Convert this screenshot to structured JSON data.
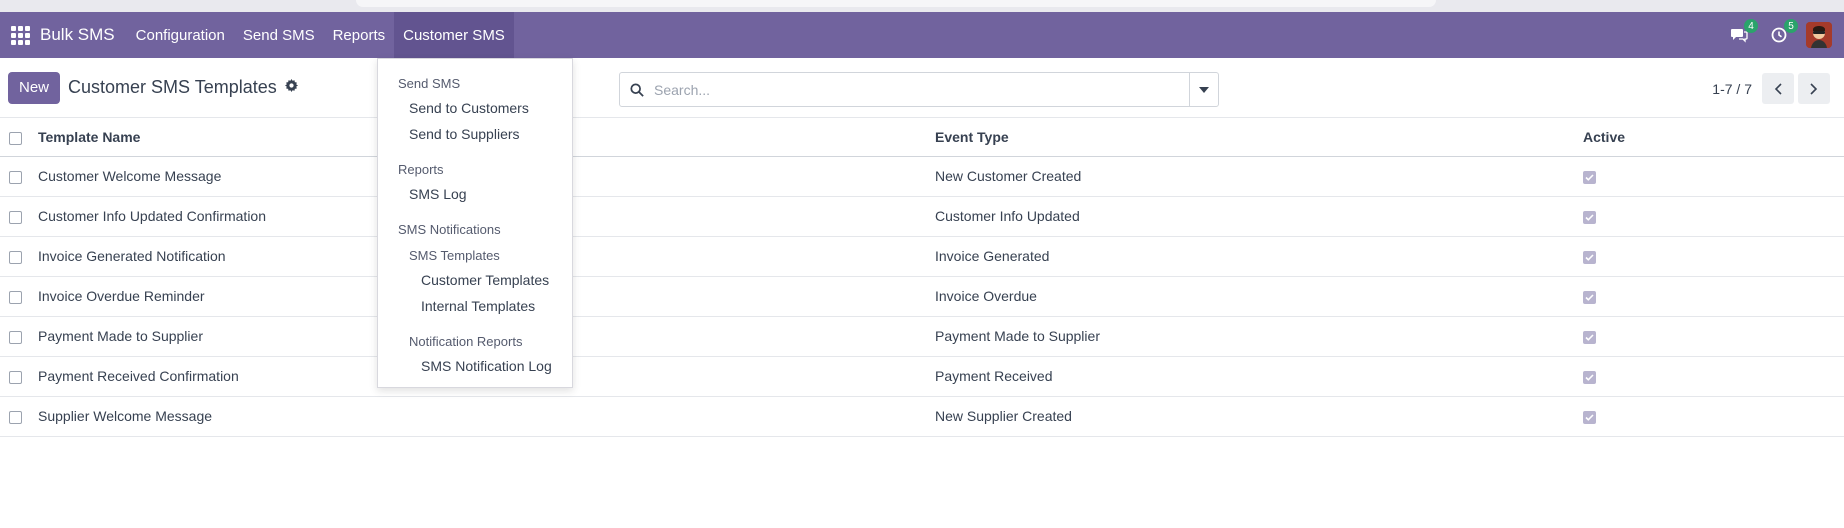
{
  "navbar": {
    "brand": "Bulk SMS",
    "menus": [
      "Configuration",
      "Send SMS",
      "Reports",
      "Customer SMS"
    ],
    "active_menu": "Customer SMS",
    "messages_badge": "4",
    "activities_badge": "5"
  },
  "control_panel": {
    "new_label": "New",
    "title": "Customer SMS Templates",
    "search_placeholder": "Search...",
    "pager": "1-7 / 7"
  },
  "table": {
    "headers": {
      "name": "Template Name",
      "event": "Event Type",
      "active": "Active"
    },
    "rows": [
      {
        "name": "Customer Welcome Message",
        "event": "New Customer Created",
        "active": true
      },
      {
        "name": "Customer Info Updated Confirmation",
        "event": "Customer Info Updated",
        "active": true
      },
      {
        "name": "Invoice Generated Notification",
        "event": "Invoice Generated",
        "active": true
      },
      {
        "name": "Invoice Overdue Reminder",
        "event": "Invoice Overdue",
        "active": true
      },
      {
        "name": "Payment Made to Supplier",
        "event": "Payment Made to Supplier",
        "active": true
      },
      {
        "name": "Payment Received Confirmation",
        "event": "Payment Received",
        "active": true
      },
      {
        "name": "Supplier Welcome Message",
        "event": "New Supplier Created",
        "active": true
      }
    ]
  },
  "dropdown": {
    "send_sms": {
      "header": "Send SMS",
      "items": [
        "Send to Customers",
        "Send to Suppliers"
      ]
    },
    "reports": {
      "header": "Reports",
      "items": [
        "SMS Log"
      ]
    },
    "sms_notifications": {
      "header": "SMS Notifications",
      "sms_templates": {
        "header": "SMS Templates",
        "items": [
          "Customer Templates",
          "Internal Templates"
        ]
      },
      "notification_reports": {
        "header": "Notification Reports",
        "items": [
          "SMS Notification Log"
        ]
      }
    }
  },
  "colors": {
    "brand": "#71639e",
    "badge": "#2aa36b"
  },
  "icons": {
    "apps": "grid-icon",
    "messages": "chat-icon",
    "activities": "clock-icon",
    "gear": "gear-icon",
    "search": "search-icon"
  }
}
